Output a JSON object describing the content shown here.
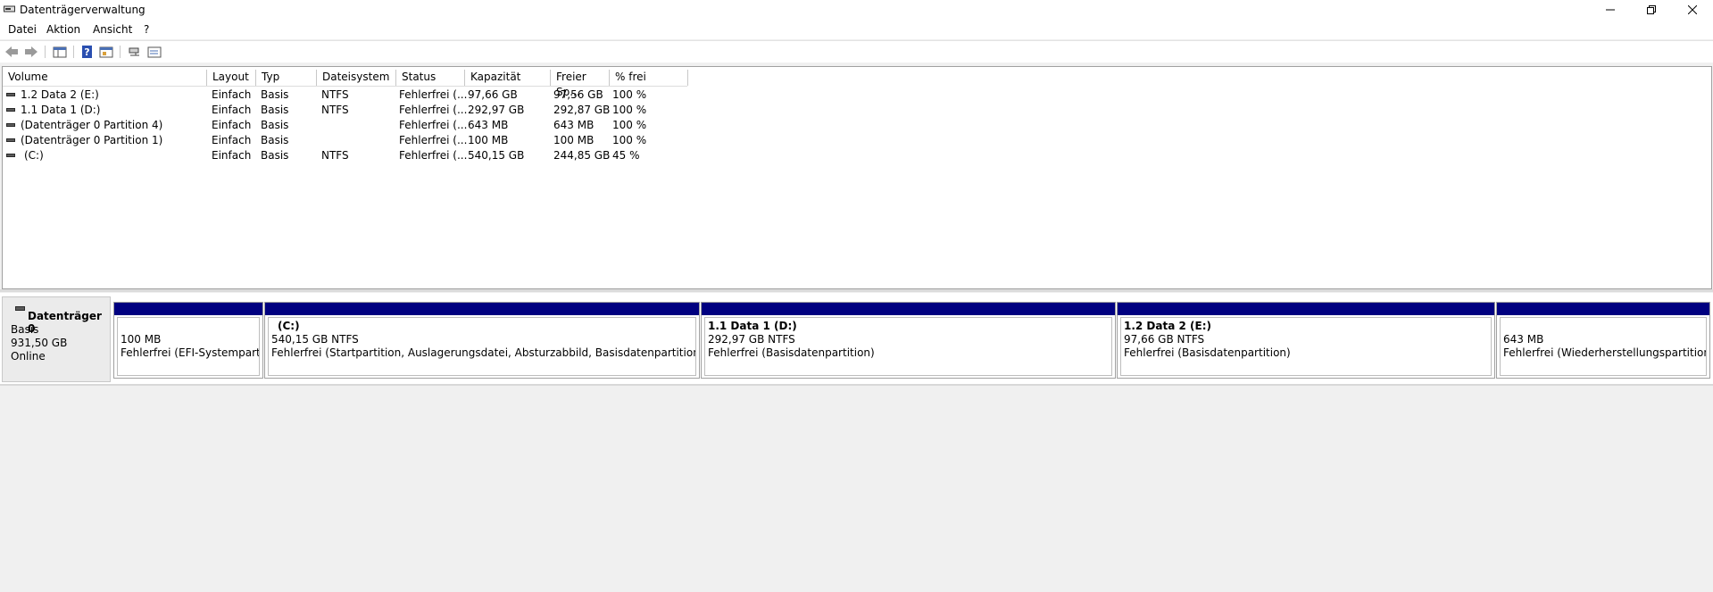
{
  "window": {
    "title": "Datenträgerverwaltung",
    "icon": "disk-management-icon"
  },
  "menu": [
    "Datei",
    "Aktion",
    "Ansicht",
    "?"
  ],
  "toolbar": {
    "icons": [
      "back-arrow-icon",
      "forward-arrow-icon",
      "console-tree-icon",
      "help-icon",
      "properties-icon",
      "refresh-icon",
      "view-icon"
    ]
  },
  "volume_list": {
    "columns": [
      "Volume",
      "Layout",
      "Typ",
      "Dateisystem",
      "Status",
      "Kapazität",
      "Freier Sp...",
      "% frei"
    ],
    "rows": [
      [
        "1.2 Data 2 (E:)",
        "Einfach",
        "Basis",
        "NTFS",
        "Fehlerfrei (...",
        "97,66 GB",
        "97,56 GB",
        "100 %"
      ],
      [
        "1.1 Data 1 (D:)",
        "Einfach",
        "Basis",
        "NTFS",
        "Fehlerfrei (...",
        "292,97 GB",
        "292,87 GB",
        "100 %"
      ],
      [
        "(Datenträger 0 Partition 4)",
        "Einfach",
        "Basis",
        "",
        "Fehlerfrei (...",
        "643 MB",
        "643 MB",
        "100 %"
      ],
      [
        "(Datenträger 0 Partition 1)",
        "Einfach",
        "Basis",
        "",
        "Fehlerfrei (...",
        "100 MB",
        "100 MB",
        "100 %"
      ],
      [
        "(C:)",
        "Einfach",
        "Basis",
        "NTFS",
        "Fehlerfrei (...",
        "540,15 GB",
        "244,85 GB",
        "45 %"
      ]
    ]
  },
  "disk": {
    "name": "Datenträger 0",
    "type": "Basis",
    "size": "931,50 GB",
    "state": "Online",
    "partitions": [
      {
        "title": "",
        "size": "100 MB",
        "status": "Fehlerfrei (EFI-Systempartition)"
      },
      {
        "title": "(C:)",
        "size": "540,15 GB NTFS",
        "status": "Fehlerfrei (Startpartition, Auslagerungsdatei, Absturzabbild, Basisdatenpartition)"
      },
      {
        "title": "1.1 Data 1  (D:)",
        "size": "292,97 GB NTFS",
        "status": "Fehlerfrei (Basisdatenpartition)"
      },
      {
        "title": "1.2 Data 2  (E:)",
        "size": "97,66 GB NTFS",
        "status": "Fehlerfrei (Basisdatenpartition)"
      },
      {
        "title": "",
        "size": "643 MB",
        "status": "Fehlerfrei (Wiederherstellungspartition)"
      }
    ]
  },
  "colors": {
    "partition_bar": "#000080",
    "background": "#f0f0f0"
  }
}
